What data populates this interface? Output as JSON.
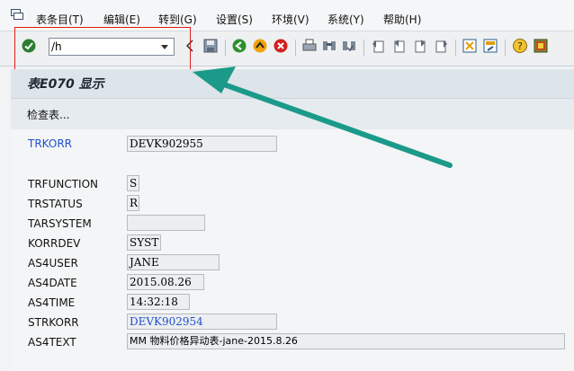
{
  "menubar": {
    "items": [
      {
        "label": "表条目(T)"
      },
      {
        "label": "编辑(E)"
      },
      {
        "label": "转到(G)"
      },
      {
        "label": "设置(S)"
      },
      {
        "label": "环境(V)"
      },
      {
        "label": "系统(Y)"
      },
      {
        "label": "帮助(H)"
      }
    ]
  },
  "toolbar": {
    "command_value": "/h",
    "icons": [
      "check-icon",
      "nav-back-arrow-icon",
      "save-icon",
      "back-icon",
      "exit-icon",
      "cancel-icon",
      "print-icon",
      "find-icon",
      "find-next-icon",
      "first-page-icon",
      "prev-page-icon",
      "next-page-icon",
      "last-page-icon",
      "new-session-icon",
      "shortcut-icon",
      "help-icon",
      "customize-layout-icon"
    ]
  },
  "title": "表E070 显示",
  "action": {
    "check_table_label": "检查表..."
  },
  "fields": [
    {
      "label": "TRKORR",
      "value": "DEVK902955",
      "link": true
    },
    {
      "label": "TRFUNCTION",
      "value": "S"
    },
    {
      "label": "TRSTATUS",
      "value": "R"
    },
    {
      "label": "TARSYSTEM",
      "value": ""
    },
    {
      "label": "KORRDEV",
      "value": "SYST"
    },
    {
      "label": "AS4USER",
      "value": "JANE"
    },
    {
      "label": "AS4DATE",
      "value": "2015.08.26"
    },
    {
      "label": "AS4TIME",
      "value": "14:32:18"
    },
    {
      "label": "STRKORR",
      "value": "DEVK902954",
      "link_value": true
    },
    {
      "label": "AS4TEXT",
      "value": "MM 物料价格异动表-jane-2015.8.26"
    }
  ],
  "colors": {
    "highlight_box": "#e21b1b",
    "arrow": "#1b9a8a",
    "link": "#1f4fd0"
  }
}
